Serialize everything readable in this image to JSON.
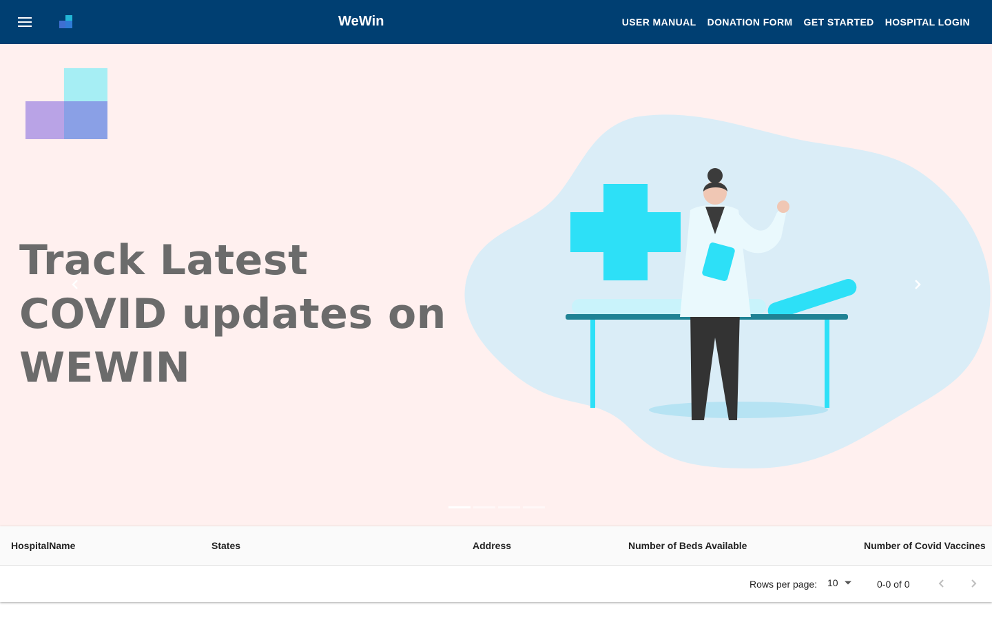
{
  "appbar": {
    "title": "WeWin",
    "menu_icon": "hamburger-menu-icon",
    "logo_icon": "wewin-logo-icon",
    "nav": [
      {
        "label": "USER MANUAL"
      },
      {
        "label": "DONATION FORM"
      },
      {
        "label": "GET STARTED"
      },
      {
        "label": "HOSPITAL LOGIN"
      }
    ],
    "background": "#003f72"
  },
  "hero": {
    "heading": "Track Latest COVID updates on WEWIN",
    "background": "#fff0ef",
    "illustration": "doctor-with-hospital-bed-illustration",
    "prev_icon": "chevron-left-icon",
    "next_icon": "chevron-right-icon",
    "slides": 4,
    "active_slide": 1
  },
  "table": {
    "columns": [
      "HospitalName",
      "States",
      "Address",
      "Number of Beds Available",
      "Number of Covid Vaccines"
    ],
    "rows": [],
    "pagination": {
      "rows_per_page_label": "Rows per page:",
      "rows_per_page": "10",
      "range": "0-0 of 0"
    }
  }
}
